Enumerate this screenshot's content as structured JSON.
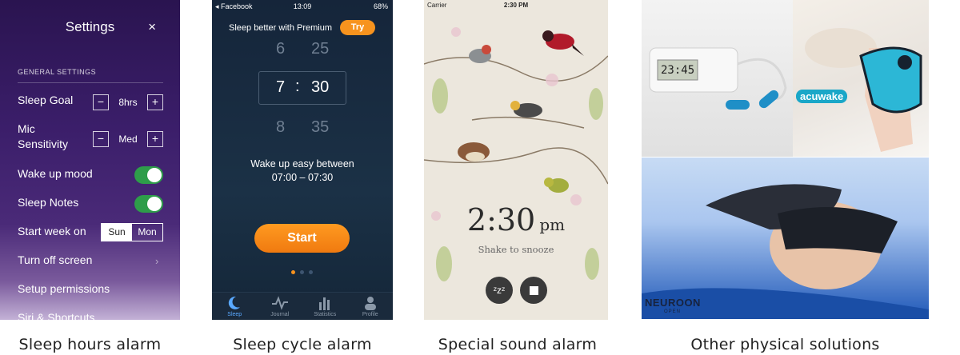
{
  "captions": [
    "Sleep hours alarm",
    "Sleep cycle alarm",
    "Special sound alarm",
    "Other physical solutions"
  ],
  "settings": {
    "title": "Settings",
    "close": "×",
    "section": "GENERAL SETTINGS",
    "sleep_goal": {
      "label": "Sleep Goal",
      "value": "8hrs",
      "minus": "−",
      "plus": "+"
    },
    "mic": {
      "label": "Mic\nSensitivity",
      "value": "Med",
      "minus": "−",
      "plus": "+"
    },
    "wake_mood": {
      "label": "Wake up mood",
      "on": true
    },
    "sleep_notes": {
      "label": "Sleep Notes",
      "on": true
    },
    "start_week": {
      "label": "Start week on",
      "options": [
        "Sun",
        "Mon"
      ],
      "selected": "Sun"
    },
    "turn_off": {
      "label": "Turn off screen",
      "chevron": "›"
    },
    "permissions": {
      "label": "Setup permissions"
    },
    "siri": {
      "label": "Siri & Shortcuts"
    }
  },
  "sleepcycle": {
    "status": {
      "back": "Facebook",
      "time": "13:09",
      "battery": "68%"
    },
    "premium": "Sleep better with Premium",
    "try": "Try",
    "picker": {
      "hour_prev": "6",
      "min_prev": "25",
      "hour": "7",
      "sep": ":",
      "min": "30",
      "hour_next": "8",
      "min_next": "35"
    },
    "wake_line1": "Wake up easy between",
    "wake_line2": "07:00 – 07:30",
    "start": "Start",
    "tabs": [
      "Sleep",
      "Journal",
      "Statistics",
      "Profile"
    ],
    "active_tab": "Sleep",
    "page_count": 3,
    "page_active": 0,
    "accent": "#f7931e"
  },
  "soundalarm": {
    "status": {
      "carrier": "Carrier",
      "time": "2:30 PM"
    },
    "time": "2:30",
    "ampm": "pm",
    "snooze": "Shake to snooze",
    "snooze_icon": "zzz",
    "stop_icon": "stop-square"
  },
  "physical": {
    "brand1": "acuwake",
    "brand2": "NEUROON",
    "brand2_sub": "OPEN",
    "device_display": "23:45"
  }
}
